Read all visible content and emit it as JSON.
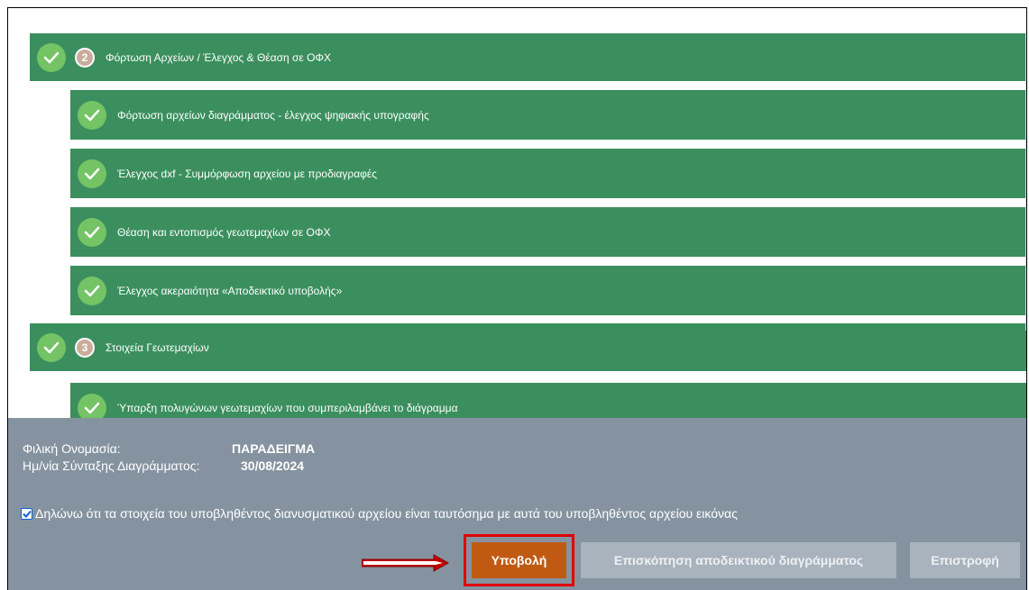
{
  "steps": [
    {
      "type": "main",
      "number": "2",
      "label": "Φόρτωση Αρχείων / Έλεγχος & Θέαση σε ΟΦΧ"
    },
    {
      "type": "sub",
      "label": "Φόρτωση αρχείων διαγράμματος - έλεγχος ψηφιακής υπογραφής"
    },
    {
      "type": "sub",
      "label": "Έλεγχος dxf - Συμμόρφωση αρχείου με προδιαγραφές"
    },
    {
      "type": "sub",
      "label": "Θέαση και εντοπισμός γεωτεμαχίων σε ΟΦΧ"
    },
    {
      "type": "sub",
      "label": "Έλεγχος ακεραιότητα «Αποδεικτικό υποβολής»"
    },
    {
      "type": "main",
      "number": "3",
      "label": "Στοιχεία Γεωτεμαχίων"
    },
    {
      "type": "sub",
      "label": "Ύπαρξη πολυγώνων γεωτεμαχίων που συμπεριλαμβάνει το διάγραμμα"
    }
  ],
  "info": {
    "friendly_name_label": "Φιλική Ονομασία:",
    "friendly_name_value": "ΠΑΡΑΔΕΙΓΜΑ",
    "date_label": "Ημ/νία Σύνταξης Διαγράμματος:",
    "date_value": "30/08/2024"
  },
  "declaration": {
    "checked": true,
    "text": "Δηλώνω ότι τα στοιχεία του υποβληθέντος διανυσματικού αρχείου είναι ταυτόσημα με αυτά του υποβληθέντος αρχείου εικόνας"
  },
  "buttons": {
    "submit": "Υποβολή",
    "preview": "Επισκόπηση αποδεικτικού διαγράμματος",
    "back": "Επιστροφή"
  },
  "colors": {
    "step_green": "#3b8f5e",
    "check_green": "#74c365",
    "submit_orange": "#c05a12",
    "highlight_red": "#e00000",
    "footer_gray": "#8593a0"
  }
}
